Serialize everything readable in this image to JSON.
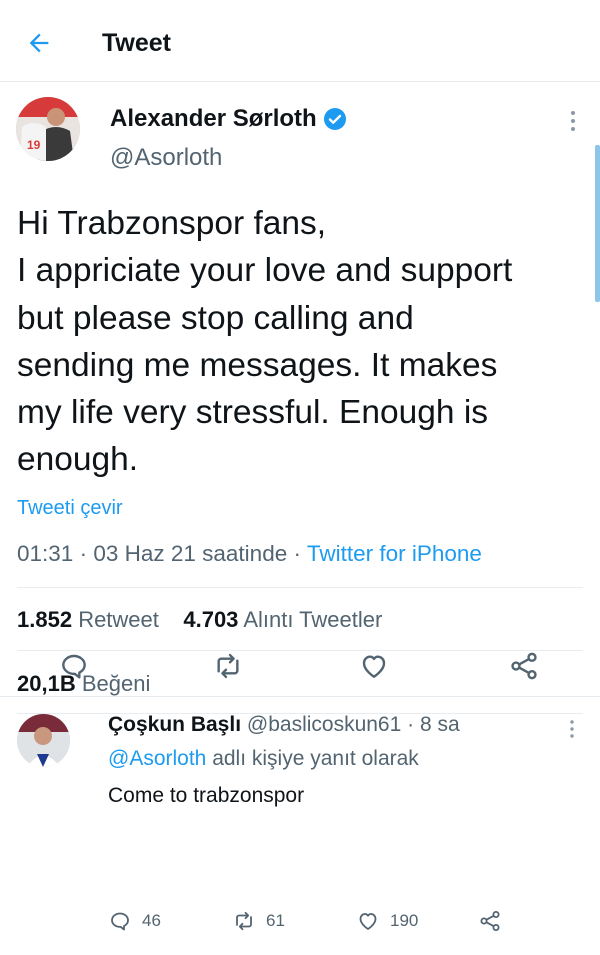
{
  "header": {
    "title": "Tweet",
    "back_icon": "arrow-left-icon"
  },
  "colors": {
    "accent": "#1d9bf0",
    "text": "#0f1419",
    "muted": "#536471",
    "divider": "#e6ecf0"
  },
  "tweet": {
    "author_name": "Alexander Sørloth",
    "author_handle": "@Asorloth",
    "verified": true,
    "body_lines": [
      "Hi Trabzonspor fans,",
      "I appriciate your love and support",
      "but please stop calling and",
      "sending me messages. It makes",
      "my life very stressful. Enough is",
      "enough."
    ],
    "translate_label": "Tweeti çevir",
    "time": "01:31",
    "date": "03 Haz 21 saatinde",
    "source": "Twitter for iPhone",
    "retweet_count": "1.852",
    "retweet_label": "Retweet",
    "quote_count": "4.703",
    "quote_label": "Alıntı Tweetler",
    "like_count": "20,1B",
    "like_label": "Beğeni"
  },
  "reply": {
    "author_name": "Çoşkun Başlı",
    "author_handle": "@baslicoskun61",
    "time": "8 sa",
    "replying_to": "@Asorloth",
    "replying_suffix": "adlı kişiye yanıt olarak",
    "text": "Come to trabzonspor",
    "reply_count": "46",
    "retweet_count": "61",
    "like_count": "190"
  }
}
